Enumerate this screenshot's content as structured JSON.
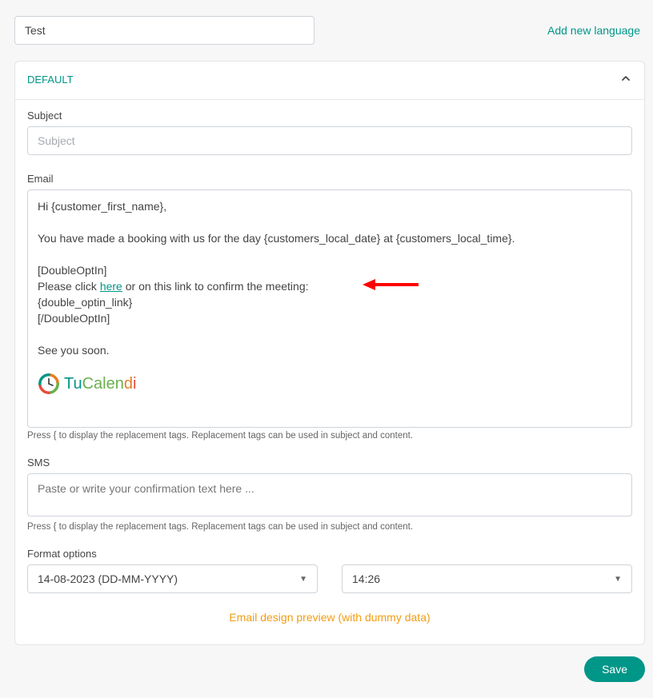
{
  "topInput": {
    "value": "Test"
  },
  "addLanguage": "Add new language",
  "panel": {
    "title": "DEFAULT"
  },
  "subject": {
    "label": "Subject",
    "placeholder": "Subject"
  },
  "email": {
    "label": "Email",
    "line1_pre": "Hi ",
    "line1_tag": "{customer_first_name}",
    "line1_post": ",",
    "line2_pre": "You have made a booking with us for the day ",
    "line2_tag1": "{customers_local_date}",
    "line2_mid": " at ",
    "line2_tag2": "{customers_local_time}",
    "line2_post": ".",
    "block_open": "[DoubleOptIn]",
    "please_pre": "Please click ",
    "please_link": "here",
    "please_post": " or on this link to confirm the meeting:",
    "optin_tag": "{double_optin_link}",
    "block_close": "[/DoubleOptIn]",
    "closing": "See you soon.",
    "brand_tu": "Tu",
    "brand_calen": "Calen",
    "brand_d": "d",
    "brand_i": "i",
    "hint": "Press { to display the replacement tags. Replacement tags can be used in subject and content."
  },
  "sms": {
    "label": "SMS",
    "placeholder": "Paste or write your confirmation text here ...",
    "hint": "Press { to display the replacement tags. Replacement tags can be used in subject and content."
  },
  "formatOptions": {
    "label": "Format options",
    "dateFormat": "14-08-2023 (DD-MM-YYYY)",
    "timeFormat": "14:26"
  },
  "previewLink": "Email design preview (with dummy data)",
  "saveLabel": "Save"
}
